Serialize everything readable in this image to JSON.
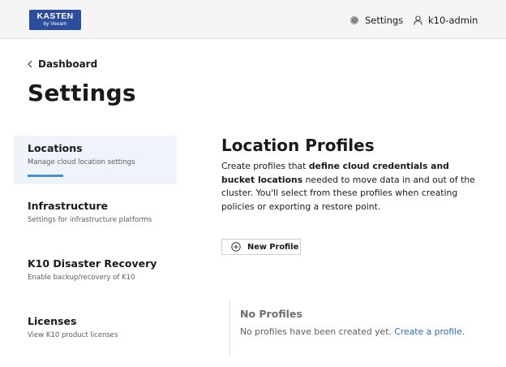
{
  "header": {
    "logo": {
      "line1": "KASTEN",
      "line2": "by Veeam"
    },
    "settings_label": "Settings",
    "user_label": "k10-admin"
  },
  "breadcrumb": {
    "label": "Dashboard"
  },
  "page_title": "Settings",
  "nav": {
    "items": [
      {
        "label": "Locations",
        "description": "Manage cloud location settings",
        "active": true
      },
      {
        "label": "Infrastructure",
        "description": "Settings for infrastructure platforms",
        "active": false
      },
      {
        "label": "K10 Disaster Recovery",
        "description": "Enable backup/recovery of K10",
        "active": false
      },
      {
        "label": "Licenses",
        "description": "View K10 product licenses",
        "active": false
      }
    ]
  },
  "main": {
    "title": "Location Profiles",
    "desc": {
      "part1": "Create profiles that ",
      "bold": "define cloud credentials and bucket locations",
      "part2": " needed to move data in and out of the cluster. You'll select from these profiles when creating policies or exporting a restore point."
    },
    "new_profile_label": "New Profile",
    "empty": {
      "title": "No Profiles",
      "text": "No profiles have been created yet. ",
      "link": "Create a profile."
    }
  },
  "colors": {
    "brand": "#2b4d9c",
    "active_bg": "#eef4f9",
    "accent": "#4a90c9",
    "link": "#2c6eb5"
  }
}
